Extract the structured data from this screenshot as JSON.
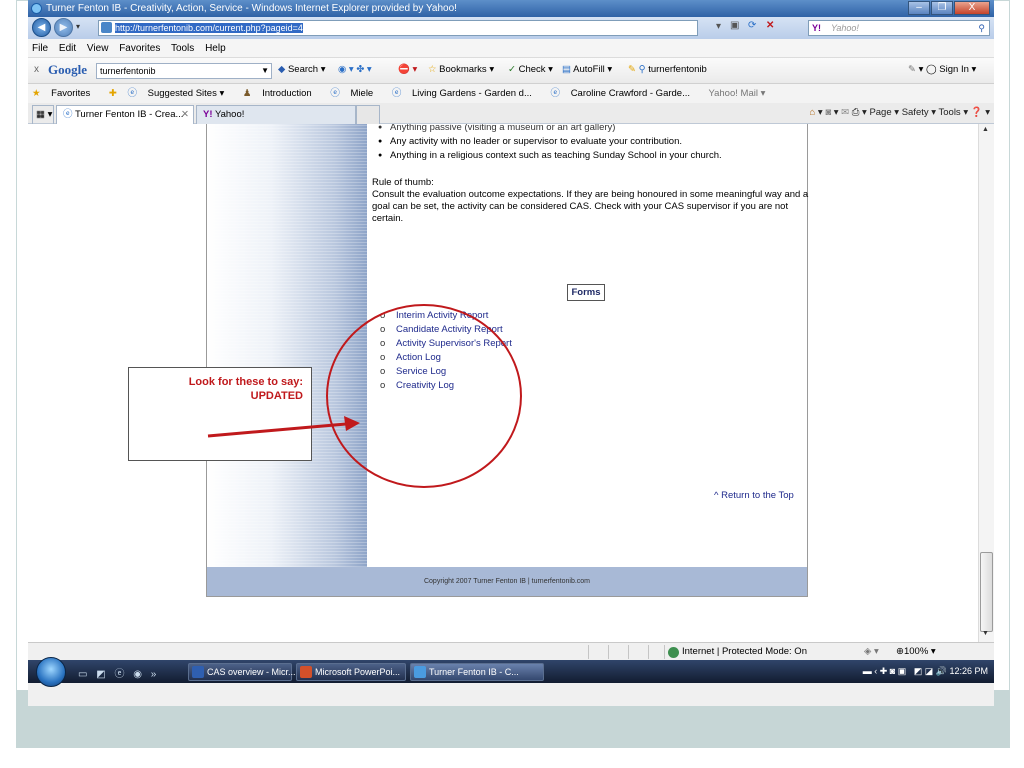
{
  "window": {
    "title": "Turner Fenton IB - Creativity, Action, Service - Windows Internet Explorer provided by Yahoo!",
    "minimize": "–",
    "maximize": "❐",
    "close": "X"
  },
  "address_bar": {
    "url": "http://turnerfentonib.com/current.php?pageid=4",
    "search_placeholder": "Yahoo!",
    "search_logo": "Y!"
  },
  "menu": [
    "File",
    "Edit",
    "View",
    "Favorites",
    "Tools",
    "Help"
  ],
  "google_bar": {
    "close": "x",
    "logo": "Google",
    "query": "turnerfentonib",
    "search": "Search",
    "bookmarks": "Bookmarks",
    "check": "Check",
    "autofill": "AutoFill",
    "highlight": "turnerfentonib",
    "sign_in": "Sign In"
  },
  "favorites_bar": {
    "favorites": "Favorites",
    "links": [
      "Suggested Sites ▾",
      "Introduction",
      "Miele",
      "Living Gardens - Garden d...",
      "Caroline Crawford - Garde...",
      "Yahoo! Mail ▾"
    ]
  },
  "tabs": [
    {
      "label": "Turner Fenton IB - Crea..."
    },
    {
      "label": "Yahoo!"
    }
  ],
  "command_bar": {
    "page": "Page ▾",
    "safety": "Safety ▾",
    "tools": "Tools ▾"
  },
  "content": {
    "bullets": [
      "Anything passive (visiting a museum or an art gallery)",
      "Any activity with no leader or supervisor to evaluate your contribution.",
      "Anything in a religious context such as teaching Sunday School in your church."
    ],
    "rule_heading": "Rule of thumb:",
    "rule_text": "Consult the evaluation outcome expectations. If they are being honoured in some meaningful way and a goal can be set, the activity can be considered CAS. Check with your CAS supervisor if you are not certain.",
    "forms_label": "Forms",
    "form_links": [
      "Interim Activity Report",
      "Candidate Activity Report",
      "Activity Supervisor's Report",
      "Action Log",
      "Service Log",
      "Creativity Log"
    ],
    "return_top": "^ Return to the Top",
    "copyright": "Copyright 2007 Turner Fenton IB | turnerfentonib.com"
  },
  "callout": {
    "line1": "Look for these to say:",
    "line2": "UPDATED",
    "color": "#c0191c"
  },
  "status_bar": {
    "zone": "Internet | Protected Mode: On",
    "zoom": "100%"
  },
  "taskbar": {
    "items": [
      "CAS overview - Micr...",
      "Microsoft PowerPoi...",
      "Turner Fenton IB - C..."
    ],
    "clock": "12:26 PM"
  }
}
